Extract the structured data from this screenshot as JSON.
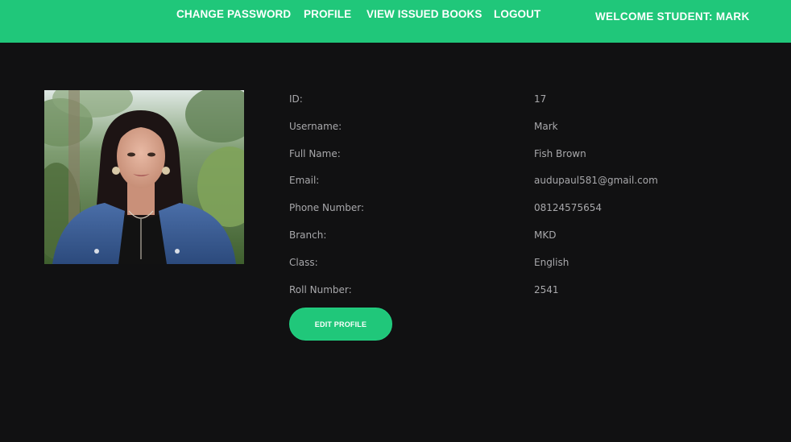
{
  "nav": {
    "links": [
      {
        "label": "CHANGE PASSWORD"
      },
      {
        "label": "PROFILE"
      },
      {
        "label": "VIEW ISSUED BOOKS"
      },
      {
        "label": "LOGOUT"
      }
    ],
    "welcome": "WELCOME STUDENT: MARK"
  },
  "profile": {
    "fields": [
      {
        "label": "ID:",
        "value": "17"
      },
      {
        "label": "Username:",
        "value": "Mark"
      },
      {
        "label": "Full Name:",
        "value": "Fish Brown"
      },
      {
        "label": "Email:",
        "value": "audupaul581@gmail.com"
      },
      {
        "label": "Phone Number:",
        "value": "08124575654"
      },
      {
        "label": "Branch:",
        "value": "MKD"
      },
      {
        "label": "Class:",
        "value": "English"
      },
      {
        "label": "Roll Number:",
        "value": "2541"
      }
    ],
    "edit_label": "EDIT PROFILE"
  },
  "colors": {
    "accent": "#20c77a",
    "background": "#111112",
    "text_muted": "#a8a8ab"
  }
}
